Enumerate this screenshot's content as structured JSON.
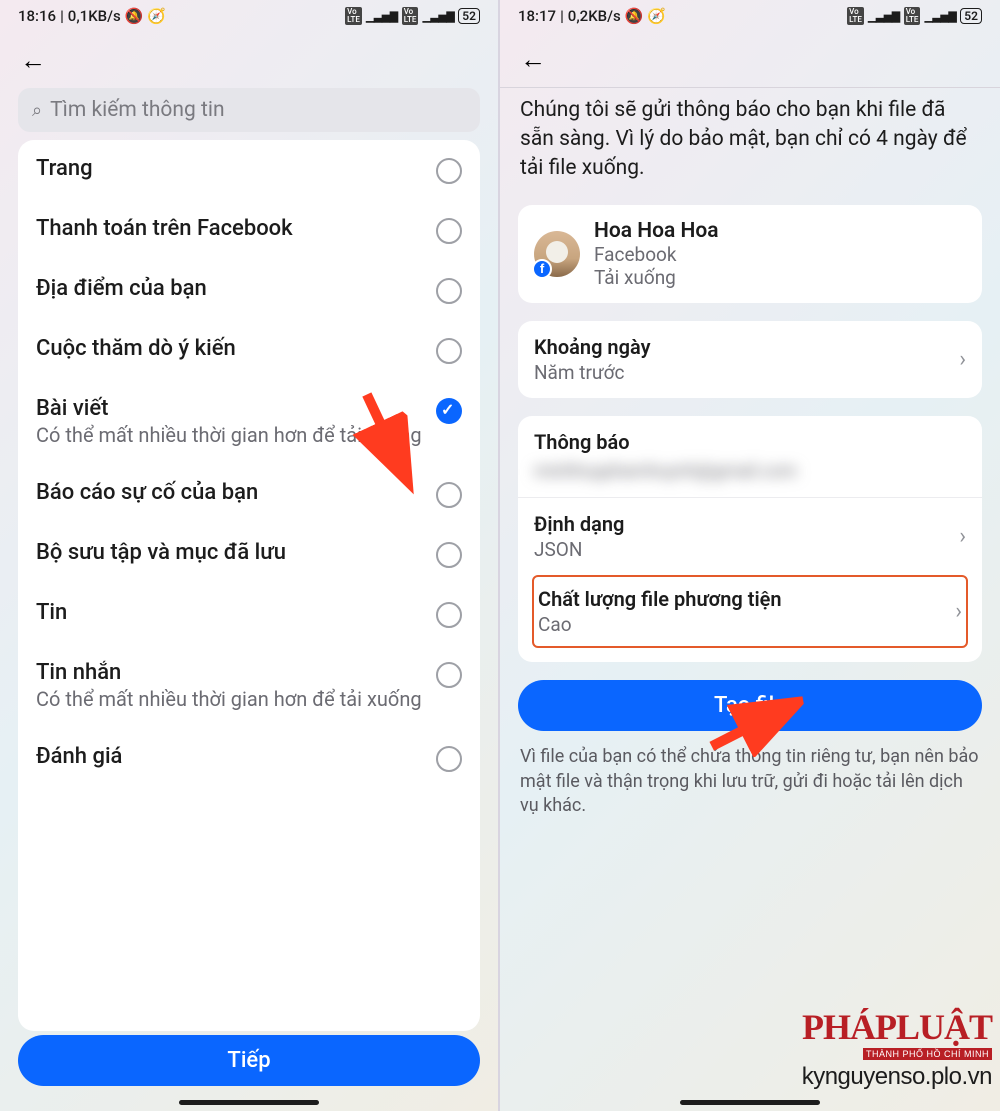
{
  "left": {
    "statusbar": {
      "time": "18:16",
      "speed": "0,1KB/s",
      "battery": "52"
    },
    "search_placeholder": "Tìm kiếm thông tin",
    "items": [
      {
        "label": "Trang",
        "sublabel": "",
        "checked": false
      },
      {
        "label": "Thanh toán trên Facebook",
        "sublabel": "",
        "checked": false
      },
      {
        "label": "Địa điểm của bạn",
        "sublabel": "",
        "checked": false
      },
      {
        "label": "Cuộc thăm dò ý kiến",
        "sublabel": "",
        "checked": false
      },
      {
        "label": "Bài viết",
        "sublabel": "Có thể mất nhiều thời gian hơn để tải xuống",
        "checked": true
      },
      {
        "label": "Báo cáo sự cố của bạn",
        "sublabel": "",
        "checked": false
      },
      {
        "label": "Bộ sưu tập và mục đã lưu",
        "sublabel": "",
        "checked": false
      },
      {
        "label": "Tin",
        "sublabel": "",
        "checked": false
      },
      {
        "label": "Tin nhắn",
        "sublabel": "Có thể mất nhiều thời gian hơn để tải xuống",
        "checked": false
      },
      {
        "label": "Đánh giá",
        "sublabel": "",
        "checked": false
      }
    ],
    "next_button": "Tiếp"
  },
  "right": {
    "statusbar": {
      "time": "18:17",
      "speed": "0,2KB/s",
      "battery": "52"
    },
    "intro": "Chúng tôi sẽ gửi thông báo cho bạn khi file đã sẵn sàng. Vì lý do bảo mật, bạn chỉ có 4 ngày để tải file xuống.",
    "profile": {
      "name": "Hoa Hoa Hoa",
      "source": "Facebook",
      "action": "Tải xuống"
    },
    "date_range": {
      "label": "Khoảng ngày",
      "value": "Năm trước"
    },
    "notification": {
      "label": "Thông báo",
      "blurred": "minhhuyphamhuynh@gmail.com"
    },
    "format": {
      "label": "Định dạng",
      "value": "JSON"
    },
    "media": {
      "label": "Chất lượng file phương tiện",
      "value": "Cao"
    },
    "create_button": "Tạo file",
    "footnote": "Vì file của bạn có thể chứa thông tin riêng tư, bạn nên bảo mật file và thận trọng khi lưu trữ, gửi đi hoặc tải lên dịch vụ khác."
  },
  "watermark": {
    "brand": "PHÁPLUẬT",
    "sub": "THÀNH PHỐ HỒ CHÍ MINH",
    "url": "kynguyenso.plo.vn"
  }
}
